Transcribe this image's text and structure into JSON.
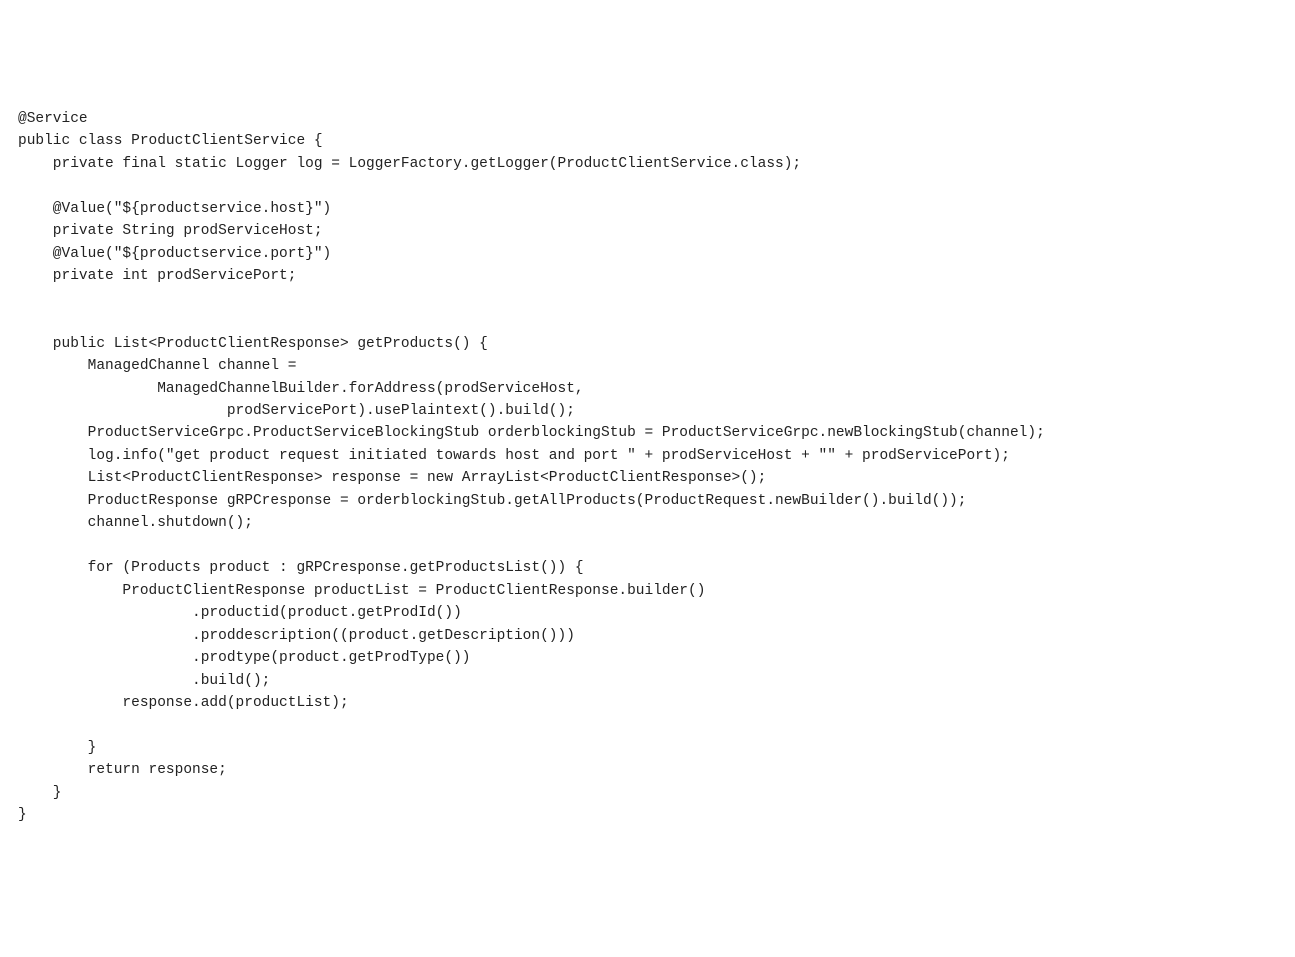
{
  "code": {
    "l01": "@Service",
    "l02": "public class ProductClientService {",
    "l03": "    private final static Logger log = LoggerFactory.getLogger(ProductClientService.class);",
    "l04": "",
    "l05": "    @Value(\"${productservice.host}\")",
    "l06": "    private String prodServiceHost;",
    "l07": "    @Value(\"${productservice.port}\")",
    "l08": "    private int prodServicePort;",
    "l09": "",
    "l10": "",
    "l11": "    public List<ProductClientResponse> getProducts() {",
    "l12": "        ManagedChannel channel =",
    "l13": "                ManagedChannelBuilder.forAddress(prodServiceHost,",
    "l14": "                        prodServicePort).usePlaintext().build();",
    "l15": "        ProductServiceGrpc.ProductServiceBlockingStub orderblockingStub = ProductServiceGrpc.newBlockingStub(channel);",
    "l16": "        log.info(\"get product request initiated towards host and port \" + prodServiceHost + \"\" + prodServicePort);",
    "l17": "        List<ProductClientResponse> response = new ArrayList<ProductClientResponse>();",
    "l18": "        ProductResponse gRPCresponse = orderblockingStub.getAllProducts(ProductRequest.newBuilder().build());",
    "l19": "        channel.shutdown();",
    "l20": "",
    "l21": "        for (Products product : gRPCresponse.getProductsList()) {",
    "l22": "            ProductClientResponse productList = ProductClientResponse.builder()",
    "l23": "                    .productid(product.getProdId())",
    "l24": "                    .proddescription((product.getDescription()))",
    "l25": "                    .prodtype(product.getProdType())",
    "l26": "                    .build();",
    "l27": "            response.add(productList);",
    "l28": "",
    "l29": "        }",
    "l30": "        return response;",
    "l31": "    }",
    "l32": "}"
  }
}
